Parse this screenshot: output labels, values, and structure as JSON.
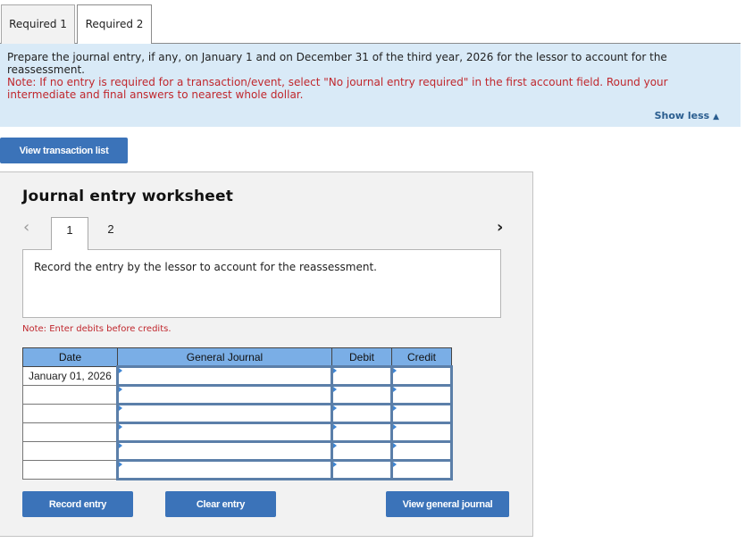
{
  "tabs": [
    {
      "label": "Required 1",
      "active": false
    },
    {
      "label": "Required 2",
      "active": true
    }
  ],
  "instructions": {
    "text": "Prepare the journal entry, if any, on January 1 and on December 31 of the third year, 2026 for the lessor to account for the reassessment.",
    "note": "Note: If no entry is required for a transaction/event, select \"No journal entry required\" in the first account field. Round your intermediate and final answers to nearest whole dollar.",
    "toggle_label": "Show less",
    "toggle_icon": "▲"
  },
  "buttons": {
    "view_transaction_list": "View transaction list",
    "record_entry": "Record entry",
    "clear_entry": "Clear entry",
    "view_general_journal": "View general journal"
  },
  "worksheet": {
    "title": "Journal entry worksheet",
    "prev_icon": "‹",
    "next_icon": "›",
    "pages": [
      "1",
      "2"
    ],
    "active_page": "1",
    "description": "Record the entry by the lessor to account for the reassessment.",
    "note": "Note: Enter debits before credits.",
    "table": {
      "headers": [
        "Date",
        "General Journal",
        "Debit",
        "Credit"
      ],
      "rows": [
        {
          "date": "January 01, 2026",
          "account": "",
          "debit": "",
          "credit": ""
        },
        {
          "date": "",
          "account": "",
          "debit": "",
          "credit": ""
        },
        {
          "date": "",
          "account": "",
          "debit": "",
          "credit": ""
        },
        {
          "date": "",
          "account": "",
          "debit": "",
          "credit": ""
        },
        {
          "date": "",
          "account": "",
          "debit": "",
          "credit": ""
        },
        {
          "date": "",
          "account": "",
          "debit": "",
          "credit": ""
        }
      ]
    }
  }
}
